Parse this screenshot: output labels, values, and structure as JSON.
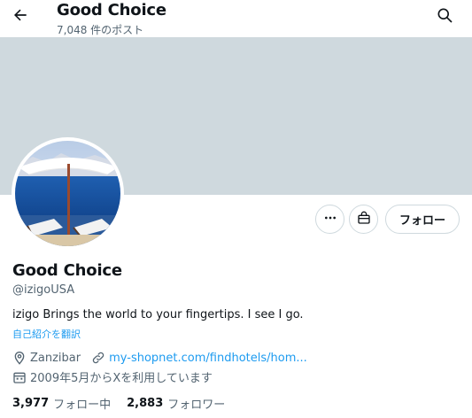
{
  "header": {
    "title": "Good Choice",
    "post_count": "7,048 件のポスト",
    "back_icon": "arrow-left-icon",
    "search_icon": "search-icon"
  },
  "banner": {
    "color": "#cfd9de"
  },
  "actions": {
    "more_icon": "more-horizontal-icon",
    "shop_icon": "shop-bag-icon",
    "follow_label": "フォロー"
  },
  "profile": {
    "name": "Good Choice",
    "handle": "@izigoUSA",
    "bio": "izigo Brings the world to your fingertips. I see I go.",
    "translate_label": "自己紹介を翻訳",
    "location": "Zanzibar",
    "website": "my-shopnet.com/findhotels/hom...",
    "joined": "2009年5月からXを利用しています"
  },
  "stats": {
    "following_count": "3,977",
    "following_label": "フォロー中",
    "followers_count": "2,883",
    "followers_label": "フォロワー"
  },
  "colors": {
    "text": "#0f1419",
    "secondary": "#536471",
    "link": "#1d9bf0",
    "border": "#cfd9de"
  }
}
